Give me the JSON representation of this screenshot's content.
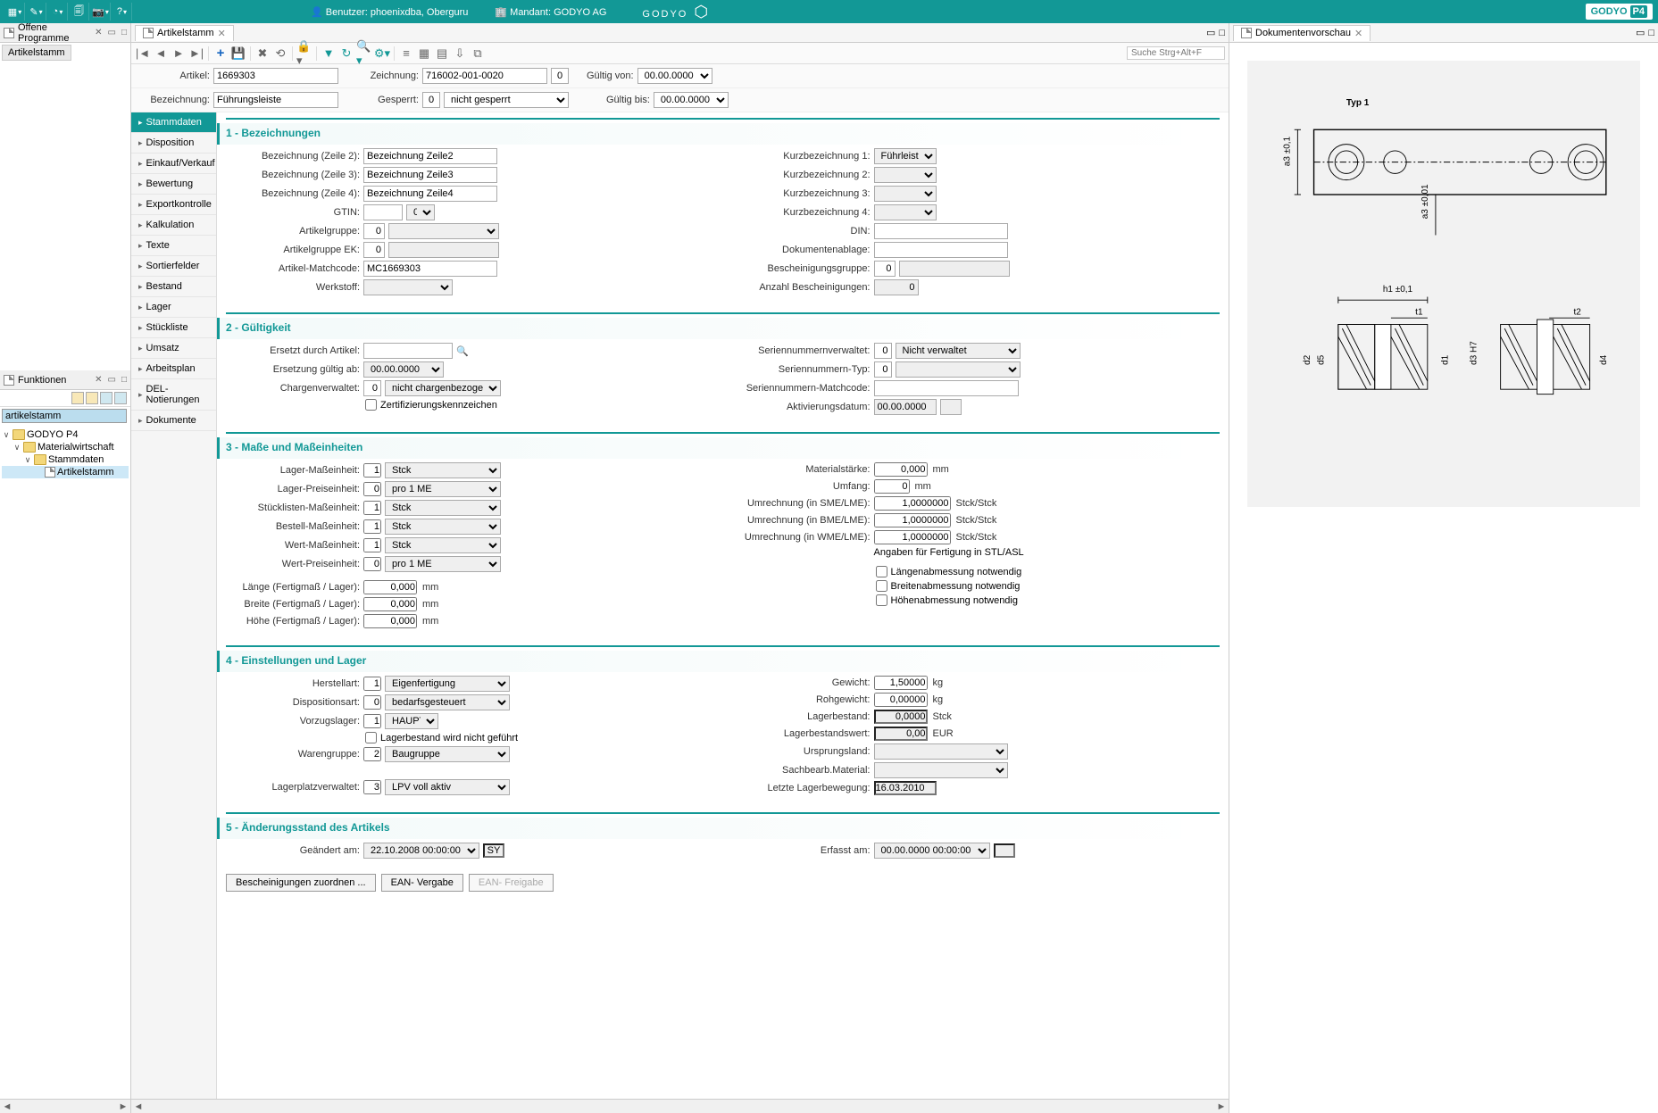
{
  "header": {
    "user_label": "Benutzer:",
    "user_value": "phoenixdba, Oberguru",
    "mandant_label": "Mandant:",
    "mandant_value": "GODYO AG",
    "logo_center": "GODYO",
    "logo_right": "GODYO",
    "logo_p4": "P4"
  },
  "panels": {
    "open_programs": "Offene Programme",
    "open_tab": "Artikelstamm",
    "functions": "Funktionen",
    "tree_search": "artikelstamm",
    "tree": {
      "root": "GODYO P4",
      "n1": "Materialwirtschaft",
      "n2": "Stammdaten",
      "n3": "Artikelstamm"
    }
  },
  "center": {
    "tab": "Artikelstamm",
    "search_hint": "Suche Strg+Alt+F",
    "head": {
      "artikel_l": "Artikel:",
      "artikel_v": "1669303",
      "zeichnung_l": "Zeichnung:",
      "zeichnung_v": "716002-001-0020",
      "zeichnung_n": "0",
      "bez_l": "Bezeichnung:",
      "bez_v": "Führungsleiste",
      "gesperrt_l": "Gesperrt:",
      "gesperrt_n": "0",
      "gesperrt_v": "nicht gesperrt",
      "gvon_l": "Gültig von:",
      "gvon_v": "00.00.0000",
      "gbis_l": "Gültig bis:",
      "gbis_v": "00.00.0000"
    },
    "sidemenu": [
      "Stammdaten",
      "Disposition",
      "Einkauf/Verkauf",
      "Bewertung",
      "Exportkontrolle",
      "Kalkulation",
      "Texte",
      "Sortierfelder",
      "Bestand",
      "Lager",
      "Stückliste",
      "Umsatz",
      "Arbeitsplan",
      "DEL-Notierungen",
      "Dokumente"
    ],
    "sections": {
      "s1": "1 - Bezeichnungen",
      "s2": "2 - Gültigkeit",
      "s3": "3 - Maße und Maßeinheiten",
      "s4": "4 - Einstellungen und Lager",
      "s5": "5 - Änderungsstand des Artikels"
    },
    "s1": {
      "bz2_l": "Bezeichnung (Zeile 2):",
      "bz2_v": "Bezeichnung Zeile2",
      "bz3_l": "Bezeichnung (Zeile 3):",
      "bz3_v": "Bezeichnung Zeile3",
      "bz4_l": "Bezeichnung (Zeile 4):",
      "bz4_v": "Bezeichnung Zeile4",
      "gtin_l": "GTIN:",
      "gtin_v": "0",
      "agrp_l": "Artikelgruppe:",
      "agrp_v": "0",
      "agrpek_l": "Artikelgruppe EK:",
      "agrpek_v": "0",
      "match_l": "Artikel-Matchcode:",
      "match_v": "MC1669303",
      "werkstoff_l": "Werkstoff:",
      "kb1_l": "Kurzbezeichnung 1:",
      "kb1_v": "Führleiste",
      "kb2_l": "Kurzbezeichnung 2:",
      "kb3_l": "Kurzbezeichnung 3:",
      "kb4_l": "Kurzbezeichnung 4:",
      "din_l": "DIN:",
      "dokabl_l": "Dokumentenablage:",
      "beschgrp_l": "Bescheinigungsgruppe:",
      "beschgrp_v": "0",
      "anzbesch_l": "Anzahl Bescheinigungen:",
      "anzbesch_v": "0"
    },
    "s2": {
      "ersetzt_l": "Ersetzt durch Artikel:",
      "ersetzab_l": "Ersetzung gültig ab:",
      "ersetzab_v": "00.00.0000",
      "chargen_l": "Chargenverwaltet:",
      "chargen_n": "0",
      "chargen_v": "nicht chargenbezogen",
      "zert_l": "Zertifizierungskennzeichen",
      "snv_l": "Seriennummernverwaltet:",
      "snv_n": "0",
      "snv_v": "Nicht verwaltet",
      "snt_l": "Seriennummern-Typ:",
      "snt_v": "0",
      "snm_l": "Seriennummern-Matchcode:",
      "aktdat_l": "Aktivierungsdatum:",
      "aktdat_v": "00.00.0000"
    },
    "s3": {
      "lme_l": "Lager-Maßeinheit:",
      "lme_n": "1",
      "lme_v": "Stck",
      "lpe_l": "Lager-Preiseinheit:",
      "lpe_n": "0",
      "lpe_v": "pro 1 ME",
      "sme_l": "Stücklisten-Maßeinheit:",
      "sme_n": "1",
      "sme_v": "Stck",
      "bme_l": "Bestell-Maßeinheit:",
      "bme_n": "1",
      "bme_v": "Stck",
      "wme_l": "Wert-Maßeinheit:",
      "wme_n": "1",
      "wme_v": "Stck",
      "wpe_l": "Wert-Preiseinheit:",
      "wpe_n": "0",
      "wpe_v": "pro 1 ME",
      "len_l": "Länge (Fertigmaß / Lager):",
      "len_v": "0,000",
      "len_u": "mm",
      "brt_l": "Breite (Fertigmaß / Lager):",
      "brt_v": "0,000",
      "brt_u": "mm",
      "hoh_l": "Höhe (Fertigmaß / Lager):",
      "hoh_v": "0,000",
      "hoh_u": "mm",
      "mst_l": "Materialstärke:",
      "mst_v": "0,000",
      "mst_u": "mm",
      "umf_l": "Umfang:",
      "umf_v": "0",
      "umf_u": "mm",
      "usme_l": "Umrechnung (in SME/LME):",
      "usme_v": "1,0000000",
      "usme_u": "Stck/Stck",
      "ubme_l": "Umrechnung (in BME/LME):",
      "ubme_v": "1,0000000",
      "ubme_u": "Stck/Stck",
      "uwme_l": "Umrechnung (in WME/LME):",
      "uwme_v": "1,0000000",
      "uwme_u": "Stck/Stck",
      "angaben": "Angaben für Fertigung in STL/ASL",
      "cb1": "Längenabmessung notwendig",
      "cb2": "Breitenabmessung notwendig",
      "cb3": "Höhenabmessung notwendig"
    },
    "s4": {
      "hart_l": "Herstellart:",
      "hart_n": "1",
      "hart_v": "Eigenfertigung",
      "disp_l": "Dispositionsart:",
      "disp_n": "0",
      "disp_v": "bedarfsgesteuert",
      "vlag_l": "Vorzugslager:",
      "vlag_n": "1",
      "vlag_v": "HAUPTL",
      "nogef": "Lagerbestand wird nicht geführt",
      "wgrp_l": "Warengruppe:",
      "wgrp_n": "2",
      "wgrp_v": "Baugruppe",
      "lpv_l": "Lagerplatzverwaltet:",
      "lpv_n": "3",
      "lpv_v": "LPV voll aktiv",
      "gew_l": "Gewicht:",
      "gew_v": "1,50000",
      "gew_u": "kg",
      "rgew_l": "Rohgewicht:",
      "rgew_v": "0,00000",
      "rgew_u": "kg",
      "lbest_l": "Lagerbestand:",
      "lbest_v": "0,0000",
      "lbest_u": "Stck",
      "lbw_l": "Lagerbestandswert:",
      "lbw_v": "0,00",
      "lbw_u": "EUR",
      "uland_l": "Ursprungsland:",
      "sbm_l": "Sachbearb.Material:",
      "llb_l": "Letzte Lagerbewegung:",
      "llb_v": "16.03.2010"
    },
    "s5": {
      "gea_l": "Geändert am:",
      "gea_v": "22.10.2008 00:00:00",
      "gea_u": "SY",
      "erf_l": "Erfasst am:",
      "erf_v": "00.00.0000 00:00:00"
    },
    "buttons": {
      "b1": "Bescheinigungen zuordnen ...",
      "b2": "EAN- Vergabe",
      "b3": "EAN- Freigabe"
    }
  },
  "right": {
    "tab": "Dokumentenvorschau",
    "drawing": {
      "typ": "Typ 1",
      "a3a": "a3 ±0,1",
      "a3b": "a3 ±0,01",
      "h1": "h1 ±0,1",
      "t1": "t1",
      "t2": "t2",
      "d1": "d1",
      "d2": "d2",
      "d3": "d3 H7",
      "d4": "d4",
      "d5": "d5"
    }
  }
}
